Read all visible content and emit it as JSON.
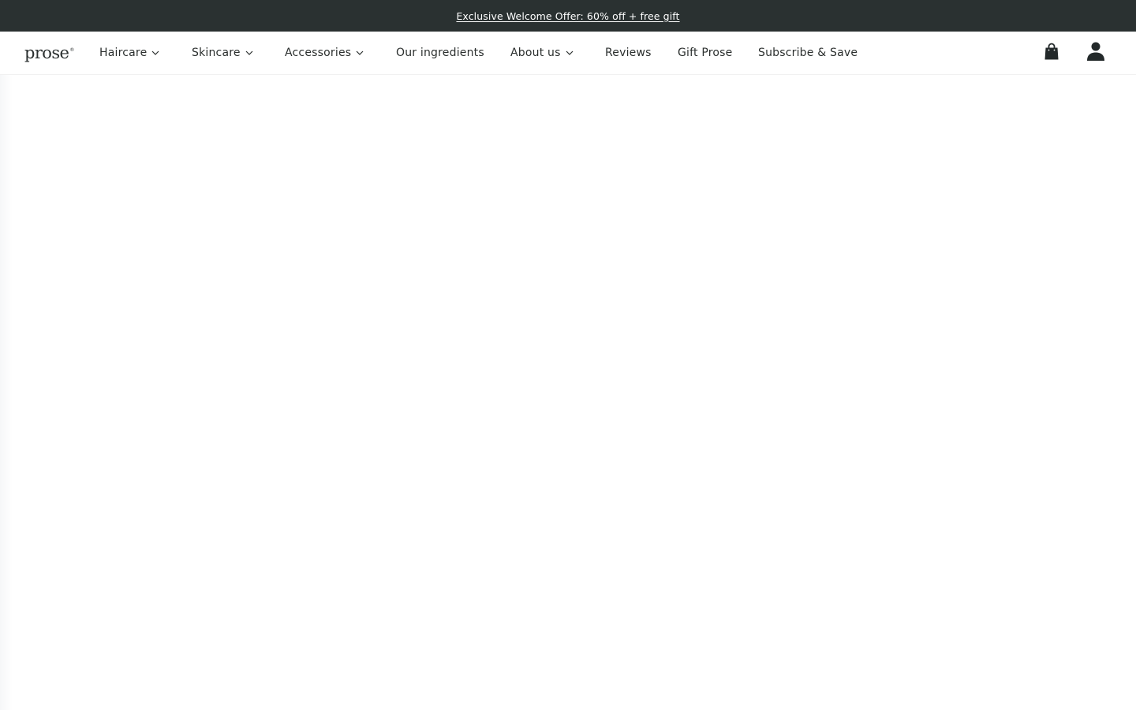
{
  "promo": {
    "text": "Exclusive Welcome Offer: 60% off + free gift"
  },
  "brand": {
    "logo_text": "prose",
    "logo_mark": "®"
  },
  "nav": {
    "items": [
      {
        "label": "Haircare",
        "has_dropdown": true
      },
      {
        "label": "Skincare",
        "has_dropdown": true
      },
      {
        "label": "Accessories",
        "has_dropdown": true
      },
      {
        "label": "Our ingredients",
        "has_dropdown": false
      },
      {
        "label": "About us",
        "has_dropdown": true
      },
      {
        "label": "Reviews",
        "has_dropdown": false
      },
      {
        "label": "Gift Prose",
        "has_dropdown": false
      },
      {
        "label": "Subscribe & Save",
        "has_dropdown": false
      }
    ]
  },
  "icons": {
    "cart": "shopping-bag-icon",
    "account": "user-icon",
    "dropdown": "chevron-down-icon"
  },
  "colors": {
    "promo_bg": "#2a3131",
    "text": "#2b2f2e",
    "background": "#ffffff"
  }
}
